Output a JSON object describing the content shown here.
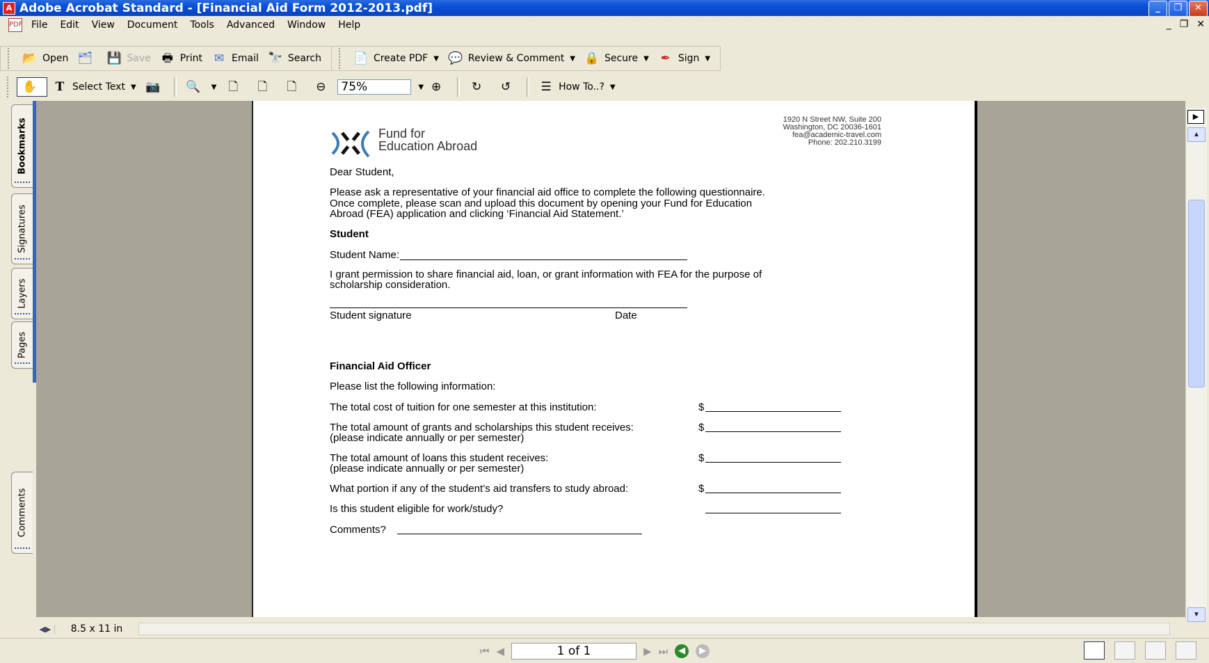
{
  "window": {
    "title": "Adobe Acrobat Standard - [Financial Aid Form 2012-2013.pdf]",
    "minimize": "_",
    "restore": "❐",
    "close": "✕"
  },
  "menu": {
    "items": [
      "File",
      "Edit",
      "View",
      "Document",
      "Tools",
      "Advanced",
      "Window",
      "Help"
    ],
    "mdi_minimize": "_",
    "mdi_restore": "❐",
    "mdi_close": "✕"
  },
  "toolbar1": {
    "open": "Open",
    "save": "Save",
    "print": "Print",
    "email": "Email",
    "search": "Search",
    "create_pdf": "Create PDF",
    "review": "Review & Comment",
    "secure": "Secure",
    "sign": "Sign"
  },
  "toolbar2": {
    "select_text": "Select Text",
    "zoom": "75%",
    "how_to": "How To..?"
  },
  "nav_tabs": [
    "Bookmarks",
    "Signatures",
    "Layers",
    "Pages",
    "Comments"
  ],
  "statusbar": {
    "page_size": "8.5 x 11 in",
    "page_indicator": "1 of 1"
  },
  "document": {
    "org_line1": "Fund for",
    "org_line2": "Education Abroad",
    "address": [
      "1920 N Street NW, Suite 200",
      "Washington, DC 20036-1601",
      "fea@academic-travel.com",
      "Phone: 202.210.3199"
    ],
    "greeting": "Dear Student,",
    "intro": [
      "Please ask a representative of your financial aid office to complete the following questionnaire.",
      "Once complete, please scan and upload this document by opening your Fund for Education",
      "Abroad (FEA) application and clicking ‘Financial Aid Statement.’"
    ],
    "student_heading": "Student",
    "student_name": "Student Name:",
    "permission": [
      "I grant permission to share financial aid, loan, or grant information with FEA for the purpose of",
      "scholarship consideration."
    ],
    "sig_label": "Student signature",
    "date_label": "Date",
    "officer_heading": "Financial Aid Officer",
    "list_prompt": "Please list the following information:",
    "q_tuition": "The total cost of tuition for one semester at this institution:",
    "q_grants": "The total amount of grants and scholarships this student receives:",
    "q_grants_note": "(please indicate annually or per semester)",
    "q_loans": "The total amount of loans this student receives:",
    "q_loans_note": "(please indicate annually or per semester)",
    "q_transfer": "What portion if any of the student’s aid transfers to study abroad:",
    "q_workstudy": "Is this student eligible for work/study?",
    "comments": "Comments?",
    "dollar": "$"
  }
}
